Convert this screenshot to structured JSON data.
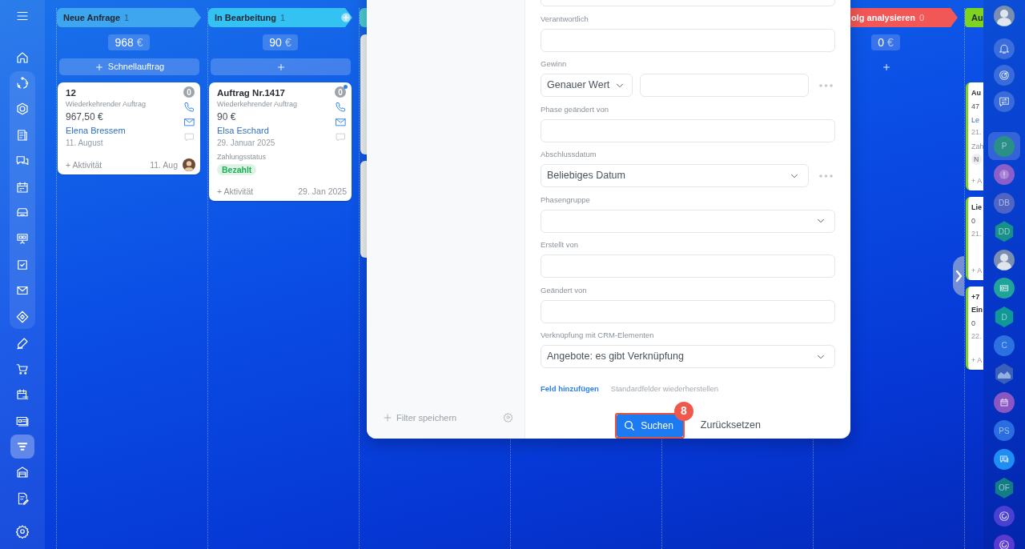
{
  "left_sidebar": {
    "sections": [
      {
        "kind": "plain",
        "items": [
          {
            "kind": "menu",
            "selected": false
          }
        ]
      },
      {
        "kind": "plain",
        "items": [
          {
            "kind": "home",
            "selected": false
          }
        ]
      },
      {
        "kind": "group",
        "items": [
          {
            "kind": "cycle",
            "selected": false
          },
          {
            "kind": "hexagon",
            "selected": false
          },
          {
            "kind": "document",
            "selected": false
          },
          {
            "kind": "chats",
            "selected": false
          },
          {
            "kind": "calendar",
            "selected": false
          },
          {
            "kind": "inbox",
            "selected": false
          },
          {
            "kind": "presentation",
            "selected": false
          },
          {
            "kind": "checkbox",
            "selected": false
          },
          {
            "kind": "mail",
            "selected": false
          },
          {
            "kind": "diamond",
            "selected": false
          }
        ]
      },
      {
        "kind": "plain",
        "items": [
          {
            "kind": "pen",
            "selected": false
          },
          {
            "kind": "cart",
            "selected": false
          },
          {
            "kind": "calendar-list",
            "selected": false
          },
          {
            "kind": "contact",
            "selected": false
          },
          {
            "kind": "funnel",
            "selected": true
          },
          {
            "kind": "warehouse",
            "selected": false
          },
          {
            "kind": "doc-edit",
            "selected": false
          }
        ]
      },
      {
        "kind": "bottom",
        "items": [
          {
            "kind": "settings",
            "selected": false
          }
        ]
      }
    ]
  },
  "columns": [
    {
      "kind": "full",
      "title": "Neue Anfrage",
      "count": "1",
      "color": "#3ea6ee",
      "add_stage": false,
      "sum": "968",
      "currency": "€",
      "add_button": true,
      "add_label": "Schnellauftrag",
      "cards": [
        {
          "counter": "0",
          "unread": false,
          "contacts": true,
          "lines": [
            {
              "kind": "title",
              "text": "12"
            },
            {
              "kind": "subtitle",
              "text": "Wiederkehrender Auftrag"
            },
            {
              "kind": "amount",
              "text": "967,50 €"
            },
            {
              "kind": "client",
              "text": "Elena Bressem"
            },
            {
              "kind": "date",
              "text": "11. August"
            }
          ],
          "footer": {
            "activity": "+ Aktivität",
            "date": "11. Aug",
            "avatar": true
          }
        }
      ]
    },
    {
      "kind": "full",
      "title": "In Bearbeitung",
      "count": "1",
      "color": "#33c2f2",
      "add_stage": true,
      "sum": "90",
      "currency": "€",
      "add_button": true,
      "cards": [
        {
          "counter": "0",
          "unread": true,
          "contacts": true,
          "lines": [
            {
              "kind": "title",
              "text": "Auftrag Nr.1417"
            },
            {
              "kind": "subtitle",
              "text": "Wiederkehrender Auftrag"
            },
            {
              "kind": "amount",
              "text": "90 €"
            },
            {
              "kind": "client",
              "text": "Elsa Eschard"
            },
            {
              "kind": "date",
              "text": "29. Januar 2025"
            },
            {
              "kind": "label",
              "text": "Zahlungsstatus"
            },
            {
              "kind": "status",
              "text": "Bezahlt",
              "color": "#1fae55"
            }
          ],
          "footer": {
            "activity": "+ Aktivität",
            "date": "29. Jan 2025",
            "avatar": false
          }
        }
      ]
    },
    {
      "kind": "covered",
      "color": "#4cc9d4",
      "cards": [
        {
          "kind": "shell"
        },
        {
          "kind": "shell"
        }
      ]
    },
    {
      "kind": "hidden"
    },
    {
      "kind": "hidden"
    },
    {
      "kind": "partly-covered",
      "title": "olg analysieren",
      "count": "0",
      "color": "#f25757",
      "sum": "0",
      "currency": "€",
      "add_button": true
    },
    {
      "kind": "clipped",
      "title": "Au",
      "color": "#7ed321",
      "cards": [
        {
          "lines": [
            {
              "kind": "title",
              "text": "Au"
            },
            {
              "kind": "amount",
              "text": "47"
            },
            {
              "kind": "client",
              "text": "Le"
            },
            {
              "kind": "date",
              "text": "21."
            },
            {
              "kind": "label",
              "text": "Zah"
            },
            {
              "kind": "status",
              "text": "N",
              "color": "#8a9098"
            }
          ],
          "footer": {
            "activity": "+ A"
          }
        },
        {
          "lines": [
            {
              "kind": "title",
              "text": "Lie"
            },
            {
              "kind": "amount",
              "text": "0"
            },
            {
              "kind": "date",
              "text": "21."
            }
          ],
          "footer": {
            "activity": "+ A"
          }
        },
        {
          "lines": [
            {
              "kind": "title",
              "text": "+7"
            },
            {
              "kind": "title",
              "text": "Ein"
            },
            {
              "kind": "amount",
              "text": "0"
            },
            {
              "kind": "date",
              "text": "22."
            }
          ],
          "footer": {
            "activity": "+ A"
          }
        }
      ]
    }
  ],
  "scroll_right": true,
  "filter": {
    "save_label": "Filter speichern",
    "fields": [
      {
        "kind": "input",
        "more": false
      },
      {
        "kind": "input",
        "label": "Verantwortlich",
        "more": false
      },
      {
        "kind": "range",
        "label": "Gewinn",
        "value": "Genauer Wert",
        "more": true
      },
      {
        "kind": "input",
        "label": "Phase geändert von",
        "more": false
      },
      {
        "kind": "select",
        "label": "Abschlussdatum",
        "value": "Beliebiges Datum",
        "more": true
      },
      {
        "kind": "select",
        "label": "Phasengruppe",
        "more": false
      },
      {
        "kind": "input",
        "label": "Erstellt von",
        "more": false
      },
      {
        "kind": "input",
        "label": "Geändert von",
        "more": false
      },
      {
        "kind": "select",
        "label": "Verknüpfung mit CRM-Elementen",
        "value": "Angebote: es gibt Verknüpfung",
        "more": false
      }
    ],
    "add_field": "Feld hinzufügen",
    "restore": "Standardfelder wiederherstellen",
    "search": {
      "label": "Suchen",
      "highlighted": true,
      "step": "8"
    },
    "reset": "Zurücksetzen"
  },
  "right_sidebar": {
    "top": [
      {
        "kind": "photo"
      },
      {
        "kind": "bell"
      },
      {
        "kind": "target"
      },
      {
        "kind": "chat-swap"
      }
    ],
    "items": [
      {
        "kind": "initials",
        "text": "P",
        "color": "#2a8f86",
        "selected": true
      },
      {
        "kind": "alert",
        "color": "#8c5ec8",
        "selected": false
      },
      {
        "kind": "initials",
        "text": "DB",
        "color": "#4f65c4",
        "selected": false
      },
      {
        "kind": "hex",
        "text": "DD",
        "color": "#17908a",
        "selected": false
      },
      {
        "kind": "photo",
        "selected": false
      },
      {
        "kind": "contact",
        "color": "#1fa39a",
        "selected": false
      },
      {
        "kind": "hex",
        "text": "D",
        "color": "#0f9896",
        "selected": false
      },
      {
        "kind": "initials",
        "text": "C",
        "color": "#2b72e0",
        "selected": false
      },
      {
        "kind": "hex-picture",
        "selected": false
      },
      {
        "kind": "calendar",
        "color": "#8a56c2",
        "selected": false
      },
      {
        "kind": "initials",
        "text": "PS",
        "color": "#2a6de0",
        "selected": false
      },
      {
        "kind": "chat",
        "color": "#1e8ef5",
        "selected": false
      },
      {
        "kind": "hex",
        "text": "OF",
        "color": "#137c86",
        "selected": false
      },
      {
        "kind": "swirl",
        "color": "#4a3fd0",
        "selected": false
      },
      {
        "kind": "swirl",
        "color": "#5a3ad0",
        "selected": false
      }
    ]
  }
}
